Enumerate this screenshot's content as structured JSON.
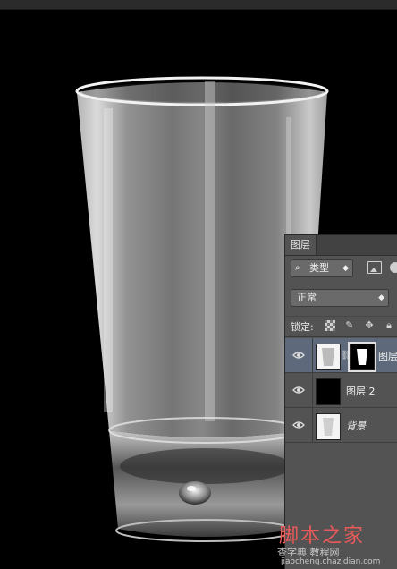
{
  "panel": {
    "tab_label": "图层",
    "filter_kind_label": "类型",
    "blend_mode": "正常",
    "lock_label": "锁定:"
  },
  "layers": [
    {
      "name": "图层",
      "selected": true,
      "visible": true
    },
    {
      "name": "图层 2",
      "selected": false,
      "visible": true
    },
    {
      "name": "背景",
      "selected": false,
      "visible": true
    }
  ],
  "watermark": {
    "title": "脚本之家",
    "subtitle": "查字典 教程网",
    "url": "jiaocheng.chazidian.com"
  },
  "colors": {
    "panel_bg": "#535353",
    "selected_layer": "#5e6a7c",
    "canvas_bg": "#000000",
    "watermark_red": "#e85a5a"
  },
  "icons": [
    "search-icon",
    "image-filter-icon",
    "circle-filter-icon",
    "lock-transparency-icon",
    "brush-icon",
    "move-icon",
    "lock-icon",
    "eye-icon",
    "chain-link-icon"
  ]
}
